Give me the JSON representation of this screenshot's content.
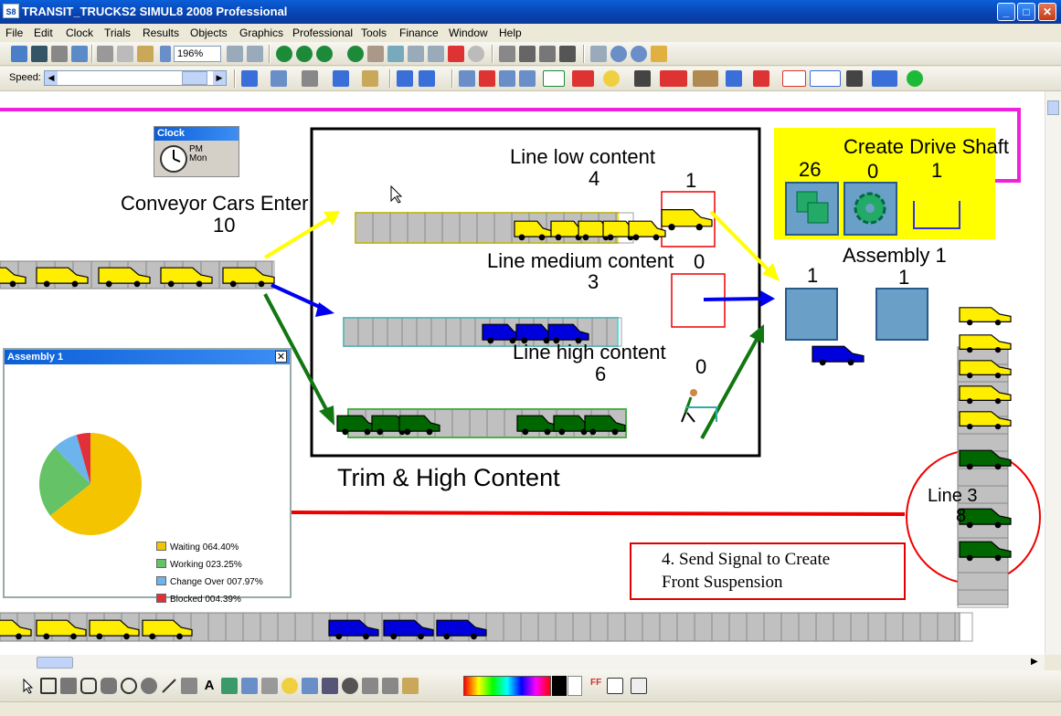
{
  "window": {
    "title": "TRANSIT_TRUCKS2   SIMUL8 2008 Professional",
    "icon": "S8",
    "minimize": "_",
    "maximize": "□",
    "close": "✕"
  },
  "menu": [
    "File",
    "Edit",
    "Clock",
    "Trials",
    "Results",
    "Objects",
    "Graphics",
    "Professional",
    "Tools",
    "Finance",
    "Window",
    "Help"
  ],
  "toolbar": {
    "zoom": "196%",
    "speed_label": "Speed:"
  },
  "clock": {
    "title": "Clock",
    "line1": "PM",
    "line2": "Mon"
  },
  "labels": {
    "conveyor_enter": "Conveyor Cars Enter",
    "conveyor_count": "10",
    "line_low": "Line low content",
    "line_low_count": "4",
    "line_low_side": "1",
    "line_medium": "Line medium content",
    "line_medium_side": "0",
    "line_medium_count": "3",
    "line_high": "Line high content",
    "line_high_count": "6",
    "line_high_side": "0",
    "group_title": "Trim & High Content",
    "drive_shaft": "Create Drive Shaft",
    "drive_count_a": "26",
    "drive_count_b": "0",
    "drive_count_c": "1",
    "assembly": "Assembly 1",
    "assembly_count_a": "1",
    "assembly_count_b": "1",
    "line3": "Line 3",
    "line3_count": "8",
    "note_line1": "4.  Send Signal to Create",
    "note_line2": "Front Suspension"
  },
  "popup": {
    "title": "Assembly 1",
    "close": "✕",
    "legend": [
      {
        "label": "Waiting 064.40%",
        "color": "#f5c400"
      },
      {
        "label": "Working 023.25%",
        "color": "#66c266"
      },
      {
        "label": "Change Over 007.97%",
        "color": "#6cb4ec"
      },
      {
        "label": "Blocked 004.39%",
        "color": "#e0303a"
      }
    ]
  },
  "chart_data": {
    "type": "pie",
    "title": "",
    "categories": [
      "Waiting",
      "Working",
      "Change Over",
      "Blocked"
    ],
    "values": [
      64.4,
      23.25,
      7.97,
      4.39
    ],
    "colors": [
      "#f5c400",
      "#66c266",
      "#6cb4ec",
      "#e0303a"
    ],
    "legend": "right"
  },
  "colors": {
    "yellow_truck": "#ffee00",
    "blue_truck": "#0000dd",
    "green_truck": "#006600",
    "magenta_path": "#ee22dd",
    "red_path": "#ee0000"
  }
}
